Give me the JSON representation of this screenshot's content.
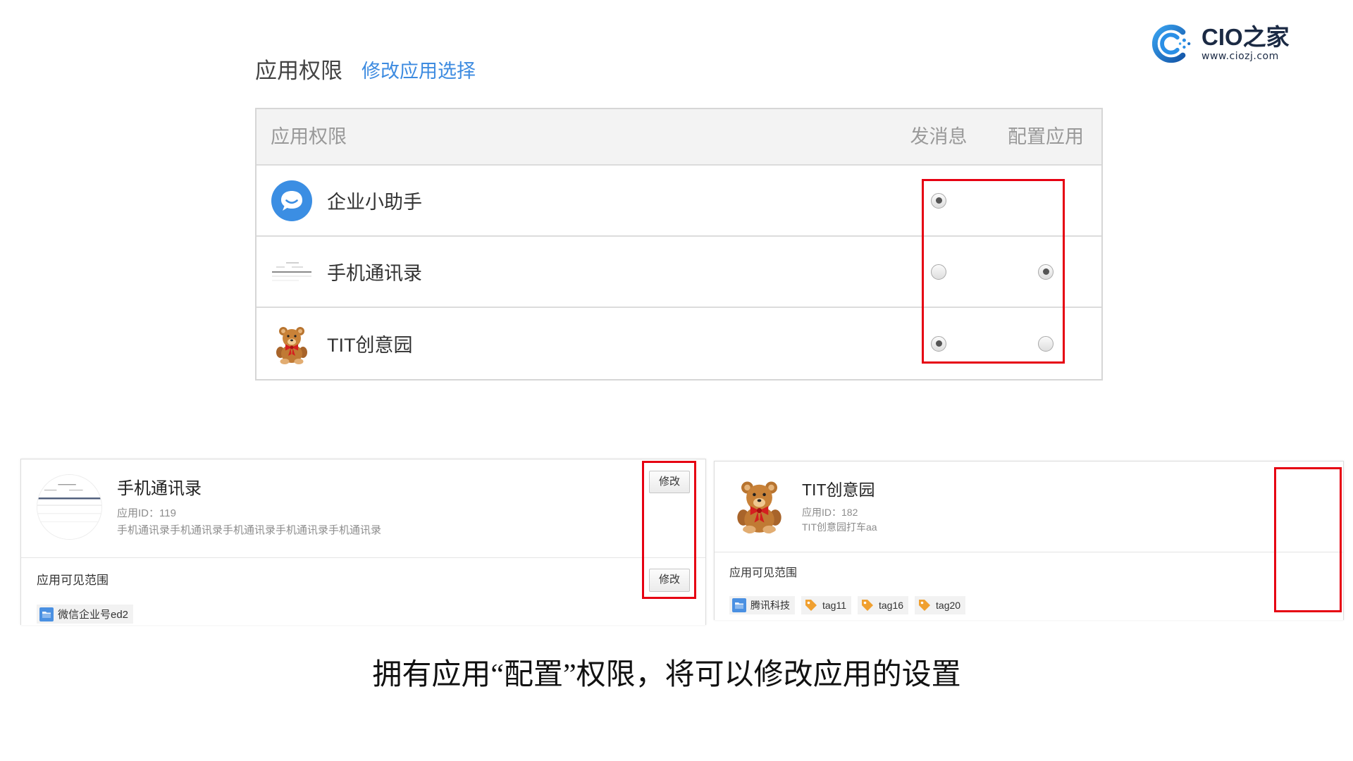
{
  "logo": {
    "name": "CIO之家",
    "url": "www.ciozj.com",
    "icon": "cio-logo-mark-icon"
  },
  "permissions": {
    "title": "应用权限",
    "edit_link": "修改应用选择",
    "table": {
      "headers": {
        "app": "应用权限",
        "send": "发消息",
        "config": "配置应用"
      },
      "rows": [
        {
          "name": "企业小助手",
          "icon": "chat-bubble-icon",
          "send": true,
          "config": null
        },
        {
          "name": "手机通讯录",
          "icon": "contacts-preview-icon",
          "send": false,
          "config": true
        },
        {
          "name": "TIT创意园",
          "icon": "teddy-bear-icon",
          "send": true,
          "config": false
        }
      ]
    }
  },
  "cards": [
    {
      "title": "手机通讯录",
      "app_id": "应用ID：119",
      "description": "手机通讯录手机通讯录手机通讯录手机通讯录手机通讯录",
      "edit_label": "修改",
      "scope_label": "应用可见范围",
      "scope_edit_label": "修改",
      "avatar_icon": "contacts-preview-icon",
      "tags": [
        {
          "icon": "folder-icon",
          "label": "微信企业号ed2"
        }
      ]
    },
    {
      "title": "TIT创意园",
      "app_id": "应用ID：182",
      "description": "TIT创意园打车aa",
      "scope_label": "应用可见范围",
      "avatar_icon": "teddy-bear-icon",
      "tags": [
        {
          "icon": "folder-icon",
          "label": "腾讯科技"
        },
        {
          "icon": "tag-icon",
          "label": "tag11"
        },
        {
          "icon": "tag-icon",
          "label": "tag16"
        },
        {
          "icon": "tag-icon",
          "label": "tag20"
        }
      ]
    }
  ],
  "caption": "拥有应用“配置”权限，将可以修改应用的设置",
  "colors": {
    "link": "#3d8be0",
    "highlight_box": "#e60012",
    "table_header_bg": "#f3f3f3",
    "logo_blue": "#2a8fe6",
    "folder_blue": "#4a90e2",
    "tag_orange": "#f0a030"
  }
}
